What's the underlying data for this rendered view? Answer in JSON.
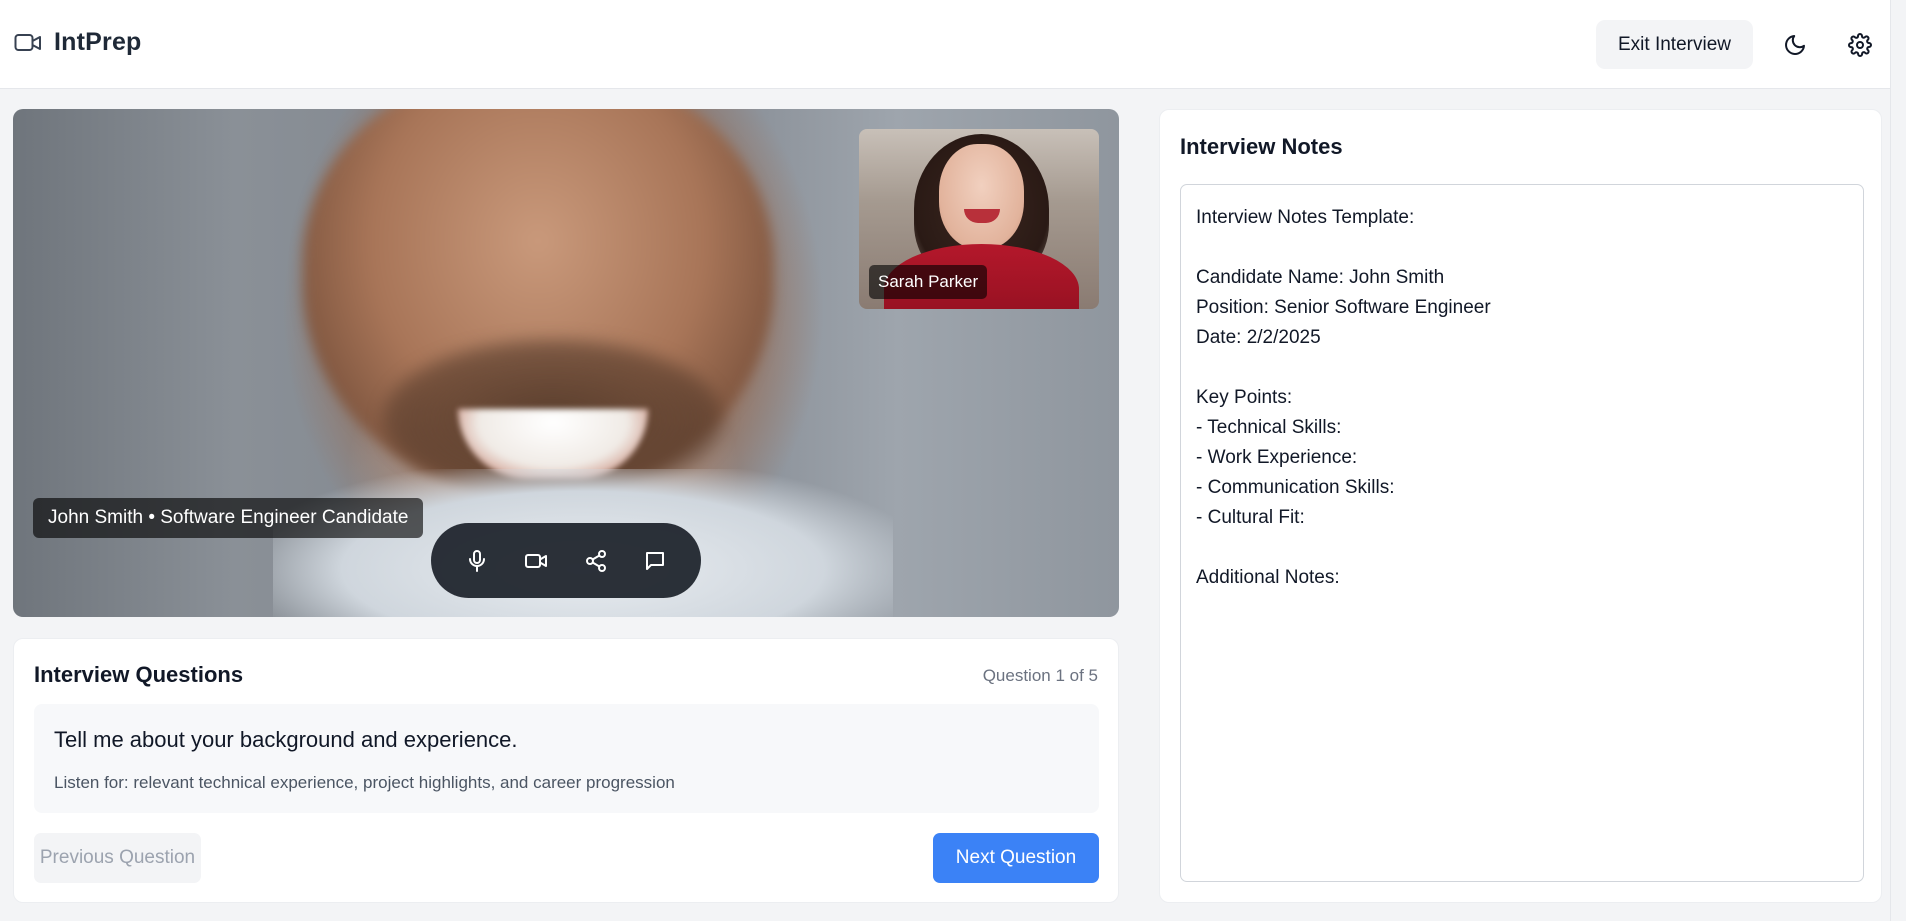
{
  "header": {
    "brand": "IntPrep",
    "brand_icon": "video-camera-icon",
    "exit_label": "Exit Interview",
    "theme_icon": "moon-icon",
    "settings_icon": "gear-icon"
  },
  "video": {
    "candidate_label": "John Smith • Software Engineer Candidate",
    "interviewer_label": "Sarah Parker",
    "controls": [
      {
        "name": "microphone-icon"
      },
      {
        "name": "camera-icon"
      },
      {
        "name": "share-icon"
      },
      {
        "name": "chat-icon"
      }
    ]
  },
  "questions": {
    "title": "Interview Questions",
    "counter": "Question 1 of 5",
    "current_question": "Tell me about your background and experience.",
    "hint": "Listen for: relevant technical experience, project highlights, and career progression",
    "prev_label": "Previous Question",
    "next_label": "Next Question"
  },
  "notes": {
    "title": "Interview Notes",
    "content": "Interview Notes Template:\n\nCandidate Name: John Smith\nPosition: Senior Software Engineer\nDate: 2/2/2025\n\nKey Points:\n- Technical Skills:\n- Work Experience:\n- Communication Skills:\n- Cultural Fit:\n\nAdditional Notes:"
  },
  "colors": {
    "accent": "#3b82f6",
    "background": "#f3f4f6",
    "controls_bar": "#1f242d"
  }
}
